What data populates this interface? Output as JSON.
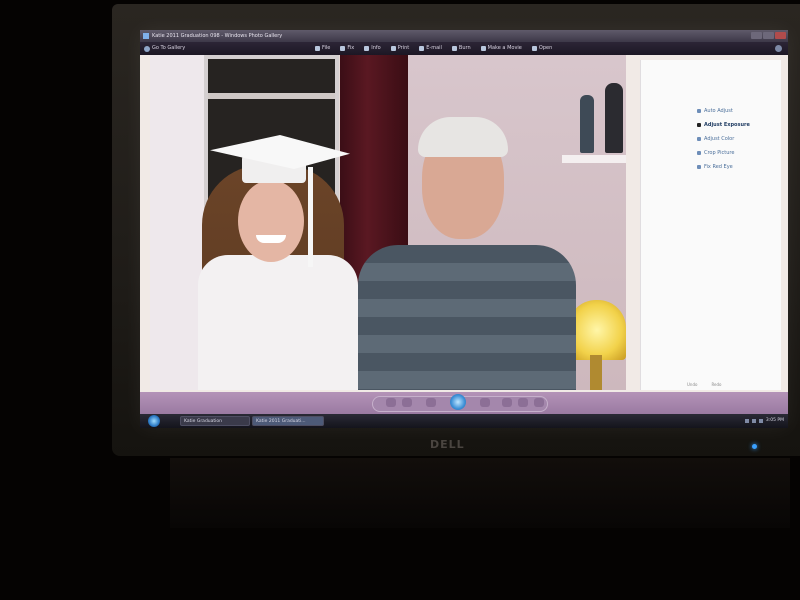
{
  "window": {
    "title": "Katie 2011 Graduation 098 - Windows Photo Gallery"
  },
  "toolbar": {
    "back_label": "Go To Gallery",
    "menu": [
      {
        "label": "File",
        "icon": "file-icon"
      },
      {
        "label": "Fix",
        "icon": "fix-icon"
      },
      {
        "label": "Info",
        "icon": "info-icon"
      },
      {
        "label": "Print",
        "icon": "print-icon"
      },
      {
        "label": "E-mail",
        "icon": "email-icon"
      },
      {
        "label": "Burn",
        "icon": "burn-icon"
      },
      {
        "label": "Make a Movie",
        "icon": "movie-icon"
      },
      {
        "label": "Open",
        "icon": "open-icon"
      }
    ]
  },
  "fix_pane": {
    "items": [
      {
        "label": "Auto Adjust",
        "active": false
      },
      {
        "label": "Adjust Exposure",
        "active": true
      },
      {
        "label": "Adjust Color",
        "active": false
      },
      {
        "label": "Crop Picture",
        "active": false
      },
      {
        "label": "Fix Red Eye",
        "active": false
      }
    ],
    "undo_label": "Undo",
    "redo_label": "Redo"
  },
  "taskbar": {
    "buttons": [
      {
        "label": "Katie Graduation",
        "active": false
      },
      {
        "label": "Katie 2011 Graduati...",
        "active": true
      }
    ],
    "clock": "3:05 PM"
  },
  "monitor": {
    "brand": "DELL"
  },
  "colors": {
    "playback_bar": "#9a7aa2",
    "taskbar": "#14141c",
    "power_led": "#3aa0ff"
  }
}
